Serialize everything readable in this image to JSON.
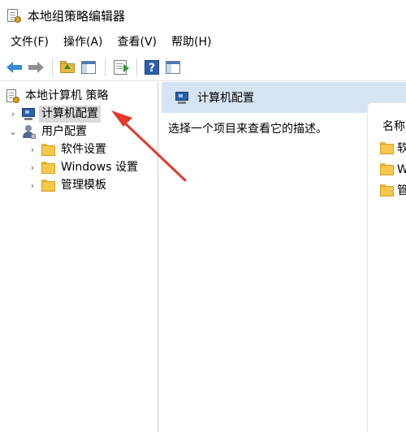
{
  "window": {
    "title": "本地组策略编辑器",
    "icon": "policy-editor-icon"
  },
  "menu": [
    {
      "label": "文件(F)"
    },
    {
      "label": "操作(A)"
    },
    {
      "label": "查看(V)"
    },
    {
      "label": "帮助(H)"
    }
  ],
  "toolbar": {
    "buttons": [
      "back-arrow-icon",
      "forward-arrow-icon",
      "folder-up-icon",
      "show-hide-tree-icon",
      "export-list-icon",
      "help-icon",
      "properties-icon"
    ]
  },
  "tree": {
    "root": "本地计算机 策略",
    "computer_config": "计算机配置",
    "user_config": "用户配置",
    "children": [
      {
        "label": "软件设置"
      },
      {
        "label": "Windows 设置"
      },
      {
        "label": "管理模板"
      }
    ]
  },
  "content": {
    "header_title": "计算机配置",
    "description": "选择一个项目来查看它的描述。",
    "list_header": "名称",
    "items": [
      {
        "label": "软件设置"
      },
      {
        "label": "Windows 设置"
      },
      {
        "label": "管理模板"
      }
    ]
  },
  "colors": {
    "header_bg": "#d5e4f3",
    "selection_bg": "#d9d9d9",
    "annotation_red": "#e23a2e",
    "folder_yellow": "#f5c84c"
  }
}
